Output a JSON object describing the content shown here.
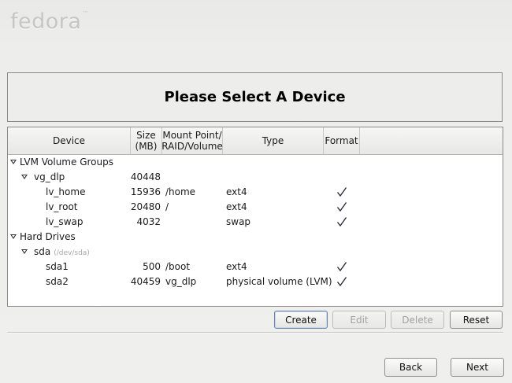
{
  "brand": {
    "name": "fedora",
    "mark": "™"
  },
  "header": {
    "title": "Please Select A Device"
  },
  "table": {
    "columns": {
      "device": "Device",
      "size_line1": "Size",
      "size_line2": "(MB)",
      "mount_line1": "Mount Point/",
      "mount_line2": "RAID/Volume",
      "type": "Type",
      "format": "Format"
    },
    "rows": [
      {
        "device": "LVM Volume Groups",
        "size": "",
        "mount": "",
        "type": "",
        "format": false,
        "expanded": true
      },
      {
        "device": "vg_dlp",
        "size": "40448",
        "mount": "",
        "type": "",
        "format": false,
        "expanded": true
      },
      {
        "device": "lv_home",
        "size": "15936",
        "mount": "/home",
        "type": "ext4",
        "format": true
      },
      {
        "device": "lv_root",
        "size": "20480",
        "mount": "/",
        "type": "ext4",
        "format": true
      },
      {
        "device": "lv_swap",
        "size": "4032",
        "mount": "",
        "type": "swap",
        "format": true
      },
      {
        "device": "Hard Drives",
        "size": "",
        "mount": "",
        "type": "",
        "format": false,
        "expanded": true
      },
      {
        "device": "sda",
        "hint": "(/dev/sda)",
        "size": "",
        "mount": "",
        "type": "",
        "format": false,
        "expanded": true
      },
      {
        "device": "sda1",
        "size": "500",
        "mount": "/boot",
        "type": "ext4",
        "format": true
      },
      {
        "device": "sda2",
        "size": "40459",
        "mount": "vg_dlp",
        "type": "physical volume (LVM)",
        "format": true
      }
    ]
  },
  "actions": {
    "create": "Create",
    "edit": "Edit",
    "delete": "Delete",
    "reset": "Reset"
  },
  "nav": {
    "back": "Back",
    "next": "Next"
  },
  "colors": {
    "default_button_border": "#6b84a8",
    "disabled_text": "#a2a2a0"
  }
}
